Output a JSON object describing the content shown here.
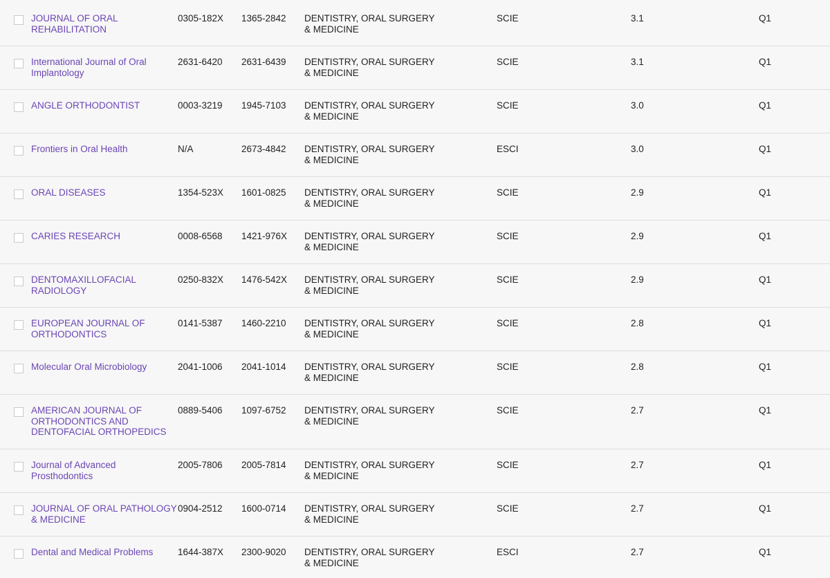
{
  "rows": [
    {
      "title": "JOURNAL OF ORAL REHABILITATION",
      "issn": "0305-182X",
      "eissn": "1365-2842",
      "category": "DENTISTRY, ORAL SURGERY & MEDICINE",
      "edition": "SCIE",
      "jif": "3.1",
      "quartile": "Q1"
    },
    {
      "title": "International Journal of Oral Implantology",
      "issn": "2631-6420",
      "eissn": "2631-6439",
      "category": "DENTISTRY, ORAL SURGERY & MEDICINE",
      "edition": "SCIE",
      "jif": "3.1",
      "quartile": "Q1"
    },
    {
      "title": "ANGLE ORTHODONTIST",
      "issn": "0003-3219",
      "eissn": "1945-7103",
      "category": "DENTISTRY, ORAL SURGERY & MEDICINE",
      "edition": "SCIE",
      "jif": "3.0",
      "quartile": "Q1"
    },
    {
      "title": "Frontiers in Oral Health",
      "issn": "N/A",
      "eissn": "2673-4842",
      "category": "DENTISTRY, ORAL SURGERY & MEDICINE",
      "edition": "ESCI",
      "jif": "3.0",
      "quartile": "Q1"
    },
    {
      "title": "ORAL DISEASES",
      "issn": "1354-523X",
      "eissn": "1601-0825",
      "category": "DENTISTRY, ORAL SURGERY & MEDICINE",
      "edition": "SCIE",
      "jif": "2.9",
      "quartile": "Q1"
    },
    {
      "title": "CARIES RESEARCH",
      "issn": "0008-6568",
      "eissn": "1421-976X",
      "category": "DENTISTRY, ORAL SURGERY & MEDICINE",
      "edition": "SCIE",
      "jif": "2.9",
      "quartile": "Q1"
    },
    {
      "title": "DENTOMAXILLOFACIAL RADIOLOGY",
      "issn": "0250-832X",
      "eissn": "1476-542X",
      "category": "DENTISTRY, ORAL SURGERY & MEDICINE",
      "edition": "SCIE",
      "jif": "2.9",
      "quartile": "Q1"
    },
    {
      "title": "EUROPEAN JOURNAL OF ORTHODONTICS",
      "issn": "0141-5387",
      "eissn": "1460-2210",
      "category": "DENTISTRY, ORAL SURGERY & MEDICINE",
      "edition": "SCIE",
      "jif": "2.8",
      "quartile": "Q1"
    },
    {
      "title": "Molecular Oral Microbiology",
      "issn": "2041-1006",
      "eissn": "2041-1014",
      "category": "DENTISTRY, ORAL SURGERY & MEDICINE",
      "edition": "SCIE",
      "jif": "2.8",
      "quartile": "Q1"
    },
    {
      "title": "AMERICAN JOURNAL OF ORTHODONTICS AND DENTOFACIAL ORTHOPEDICS",
      "issn": "0889-5406",
      "eissn": "1097-6752",
      "category": "DENTISTRY, ORAL SURGERY & MEDICINE",
      "edition": "SCIE",
      "jif": "2.7",
      "quartile": "Q1"
    },
    {
      "title": "Journal of Advanced Prosthodontics",
      "issn": "2005-7806",
      "eissn": "2005-7814",
      "category": "DENTISTRY, ORAL SURGERY & MEDICINE",
      "edition": "SCIE",
      "jif": "2.7",
      "quartile": "Q1"
    },
    {
      "title": "JOURNAL OF ORAL PATHOLOGY & MEDICINE",
      "issn": "0904-2512",
      "eissn": "1600-0714",
      "category": "DENTISTRY, ORAL SURGERY & MEDICINE",
      "edition": "SCIE",
      "jif": "2.7",
      "quartile": "Q1"
    },
    {
      "title": "Dental and Medical Problems",
      "issn": "1644-387X",
      "eissn": "2300-9020",
      "category": "DENTISTRY, ORAL SURGERY & MEDICINE",
      "edition": "ESCI",
      "jif": "2.7",
      "quartile": "Q1"
    }
  ]
}
